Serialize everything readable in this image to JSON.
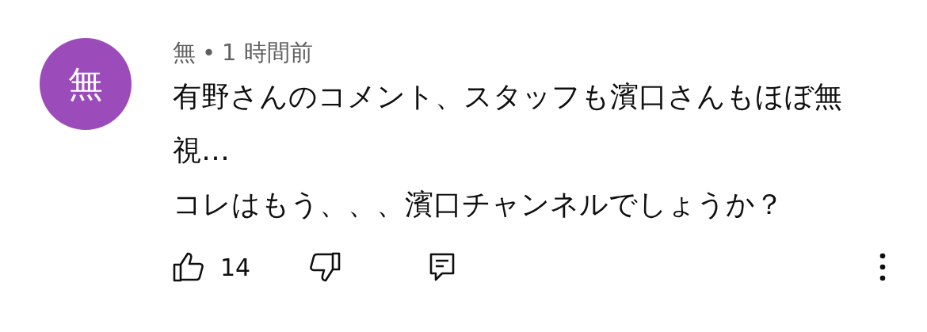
{
  "comment": {
    "avatar": {
      "letter": "無",
      "color": "#9c4bba"
    },
    "author": "無",
    "separator": "•",
    "time": "1 時間前",
    "text": "有野さんのコメント、スタッフも濱口さんもほぼ無視…\nコレはもう、、、濱口チャンネルでしょうか？",
    "likes": "14"
  }
}
